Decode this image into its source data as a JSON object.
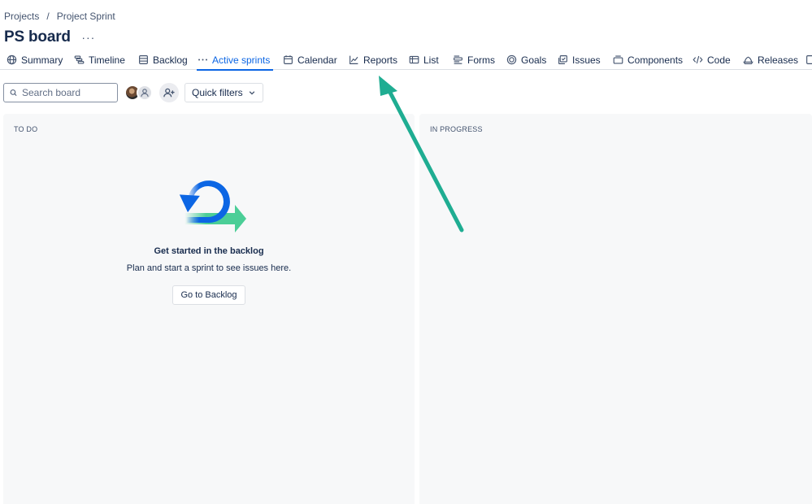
{
  "breadcrumb": {
    "items": [
      "Projects",
      "Project Sprint"
    ],
    "separator": "/"
  },
  "header": {
    "title": "PS board",
    "more_label": "···"
  },
  "tabs": [
    {
      "label": "Summary",
      "icon": "globe-icon"
    },
    {
      "label": "Timeline",
      "icon": "timeline-icon"
    },
    {
      "label": "Backlog",
      "icon": "backlog-icon"
    },
    {
      "label": "Active sprints",
      "icon": "more-dots-icon",
      "active": true
    },
    {
      "label": "Calendar",
      "icon": "calendar-icon"
    },
    {
      "label": "Reports",
      "icon": "reports-icon"
    },
    {
      "label": "List",
      "icon": "list-icon"
    },
    {
      "label": "Forms",
      "icon": "forms-icon"
    },
    {
      "label": "Goals",
      "icon": "goals-icon"
    },
    {
      "label": "Issues",
      "icon": "issues-icon"
    },
    {
      "label": "Components",
      "icon": "components-icon"
    },
    {
      "label": "Code",
      "icon": "code-icon"
    },
    {
      "label": "Releases",
      "icon": "releases-icon"
    }
  ],
  "toolbar": {
    "search_placeholder": "Search board",
    "quick_filters_label": "Quick filters"
  },
  "columns": {
    "todo": {
      "header": "TO DO",
      "empty_title": "Get started in the backlog",
      "empty_description": "Plan and start a sprint to see issues here.",
      "button_label": "Go to Backlog"
    },
    "inprogress": {
      "header": "IN PROGRESS"
    }
  },
  "colors": {
    "accent": "#0c66e4",
    "annotation_arrow": "#1fad92",
    "illustration_blue": "#0c66e4",
    "illustration_green": "#4bce97"
  }
}
